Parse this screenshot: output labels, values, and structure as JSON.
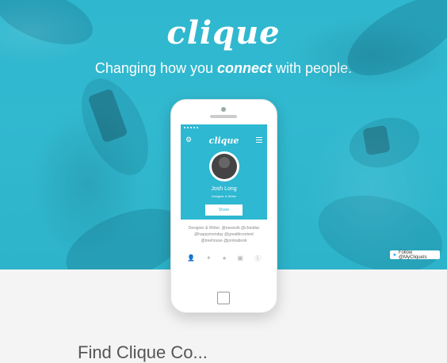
{
  "brand": {
    "logo": "clique",
    "tagline_before": "Changing how you ",
    "tagline_emphasis": "connect",
    "tagline_after": " with people."
  },
  "twitter": {
    "label": "Follow @MyCliqueIs",
    "icon": "twitter-bird-icon"
  },
  "phone": {
    "app_logo": "clique",
    "profile": {
      "name": "Josh Long",
      "role": "Designer & Writer",
      "share_label": "Share"
    },
    "bio": "Designer & Writer. @newsvib @cheddar @happymonday @greatblcontent @treehouse @jomkabook",
    "social_icons": [
      "user-icon",
      "twitter-icon",
      "github-icon",
      "instagram-icon",
      "skype-icon"
    ]
  },
  "below": {
    "heading_partial": "Find Clique Co..."
  },
  "colors": {
    "accent": "#2eb8d1",
    "page_bg": "#f4f4f4"
  }
}
